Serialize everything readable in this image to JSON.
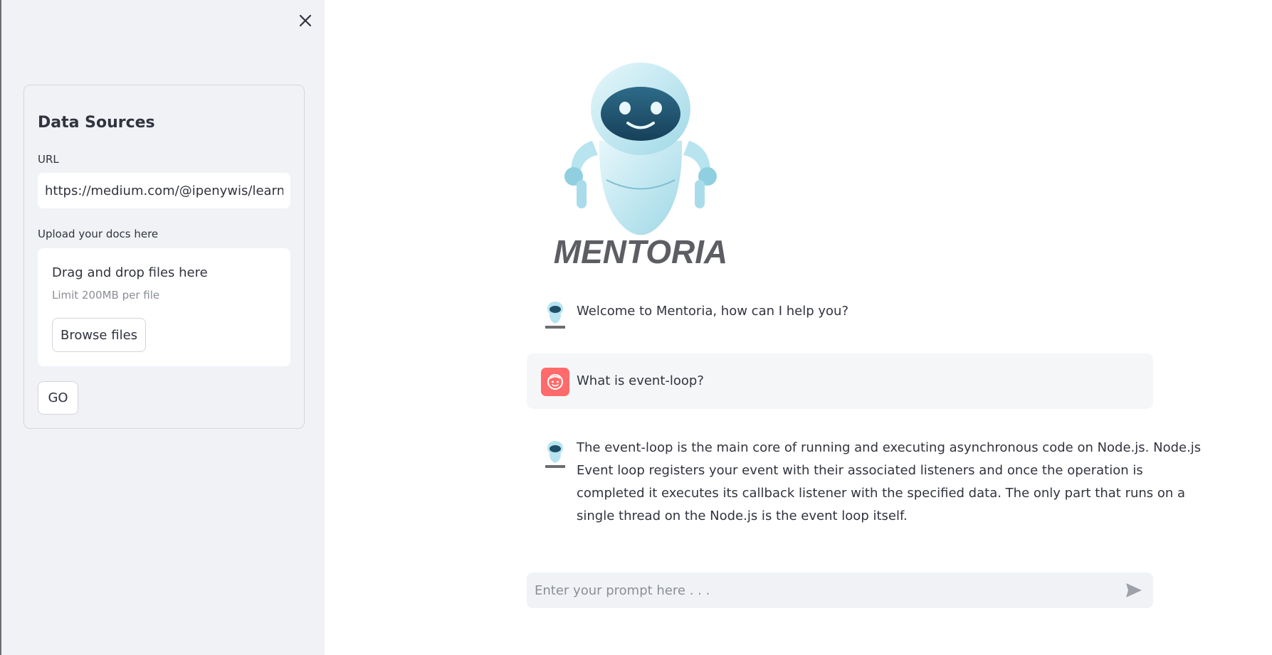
{
  "sidebar": {
    "close_icon": "close-icon",
    "title": "Data Sources",
    "url_label": "URL",
    "url_value": "https://medium.com/@ipenywis/learn-r",
    "upload_label": "Upload your docs here",
    "dropzone_title": "Drag and drop files here",
    "dropzone_limit": "Limit 200MB per file",
    "browse_label": "Browse files",
    "go_label": "GO"
  },
  "logo": {
    "text": "MENTORIA"
  },
  "chat": {
    "messages": [
      {
        "role": "assistant",
        "text": "Welcome to Mentoria, how can I help you?"
      },
      {
        "role": "user",
        "text": "What is event-loop?"
      },
      {
        "role": "assistant",
        "lines": [
          "The event-loop is the main core of running and executing asynchronous code on Node.js. Node.js",
          "Event loop registers your event with their associated listeners and once the operation is",
          "completed it executes its callback listener with the specified data. The only part that runs on a",
          "single thread on the Node.js is the event loop itself."
        ]
      }
    ]
  },
  "prompt": {
    "placeholder": "Enter your prompt here . . .",
    "send_icon": "send-icon"
  },
  "colors": {
    "sidebar_bg": "#f0f2f6",
    "user_avatar": "#ff6b6b",
    "text": "#31333f",
    "robot_accent": "#a7dce8"
  }
}
